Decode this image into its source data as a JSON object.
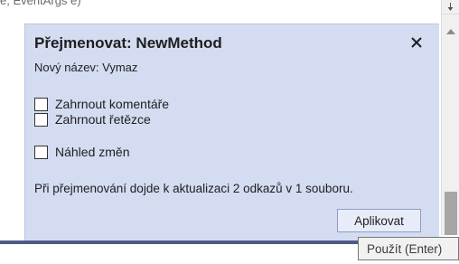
{
  "editor": {
    "partial_line": "e, EventArgs e)"
  },
  "rename_panel": {
    "title": "Přejmenovat: NewMethod",
    "new_name": "Nový název: Vymaz",
    "options": [
      {
        "label": "Zahrnout komentáře",
        "checked": false
      },
      {
        "label": "Zahrnout řetězce",
        "checked": false
      },
      {
        "label": "Náhled změn",
        "checked": false
      }
    ],
    "status": "Při přejmenování dojde k aktualizaci 2 odkazů v 1 souboru.",
    "apply_label": "Aplikovat",
    "close_icon": "close-icon"
  },
  "tooltip": {
    "text": "Použít (Enter)"
  },
  "colors": {
    "panel_bg": "#d3dcf1",
    "editor_border": "#4d5b84",
    "button_border": "#8f9cc4"
  }
}
